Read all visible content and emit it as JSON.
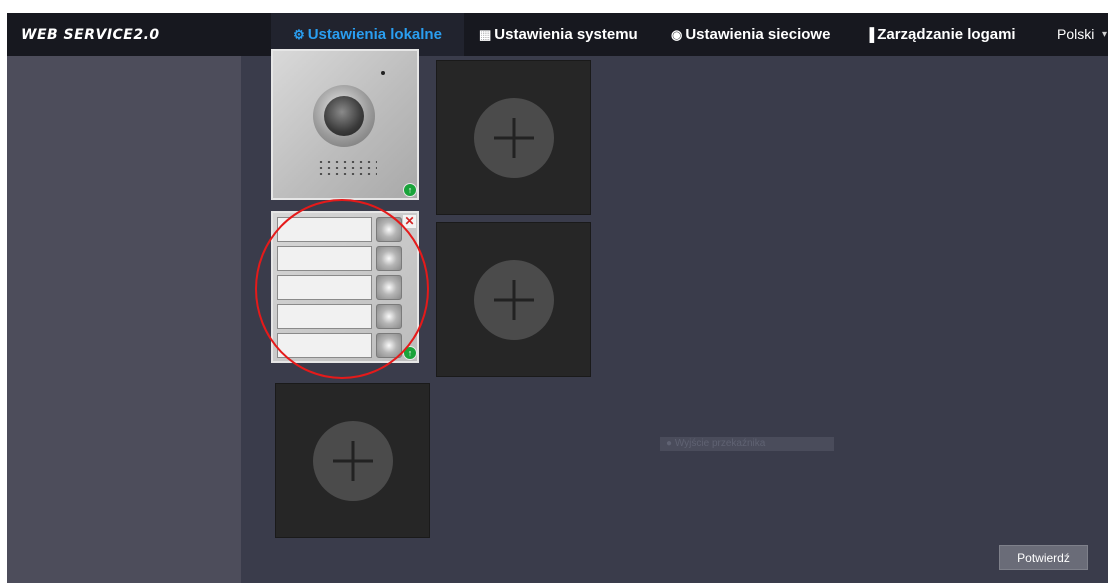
{
  "app": {
    "title": "WEB SERVICE2.0"
  },
  "nav": {
    "items": [
      {
        "label": "Ustawienia lokalne",
        "icon": "gear-icon",
        "active": true
      },
      {
        "label": "Ustawienia systemu",
        "icon": "building-icon",
        "active": false
      },
      {
        "label": "Ustawienia sieciowe",
        "icon": "globe-icon",
        "active": false
      },
      {
        "label": "Zarządzanie logami",
        "icon": "log-icon",
        "active": false
      }
    ],
    "language": "Polski",
    "accent_color": "#2a9ef0"
  },
  "modules": {
    "camera_module": {
      "icon": "upload-icon"
    },
    "button_module": {
      "button_count": 5,
      "delete_icon": "close-icon",
      "upload_icon": "upload-icon"
    }
  },
  "output": {
    "label": "Wyjście przekaźnika"
  },
  "actions": {
    "confirm_label": "Potwierdź"
  },
  "colors": {
    "highlight": "#e51a1a",
    "upload_green": "#19a33a"
  }
}
